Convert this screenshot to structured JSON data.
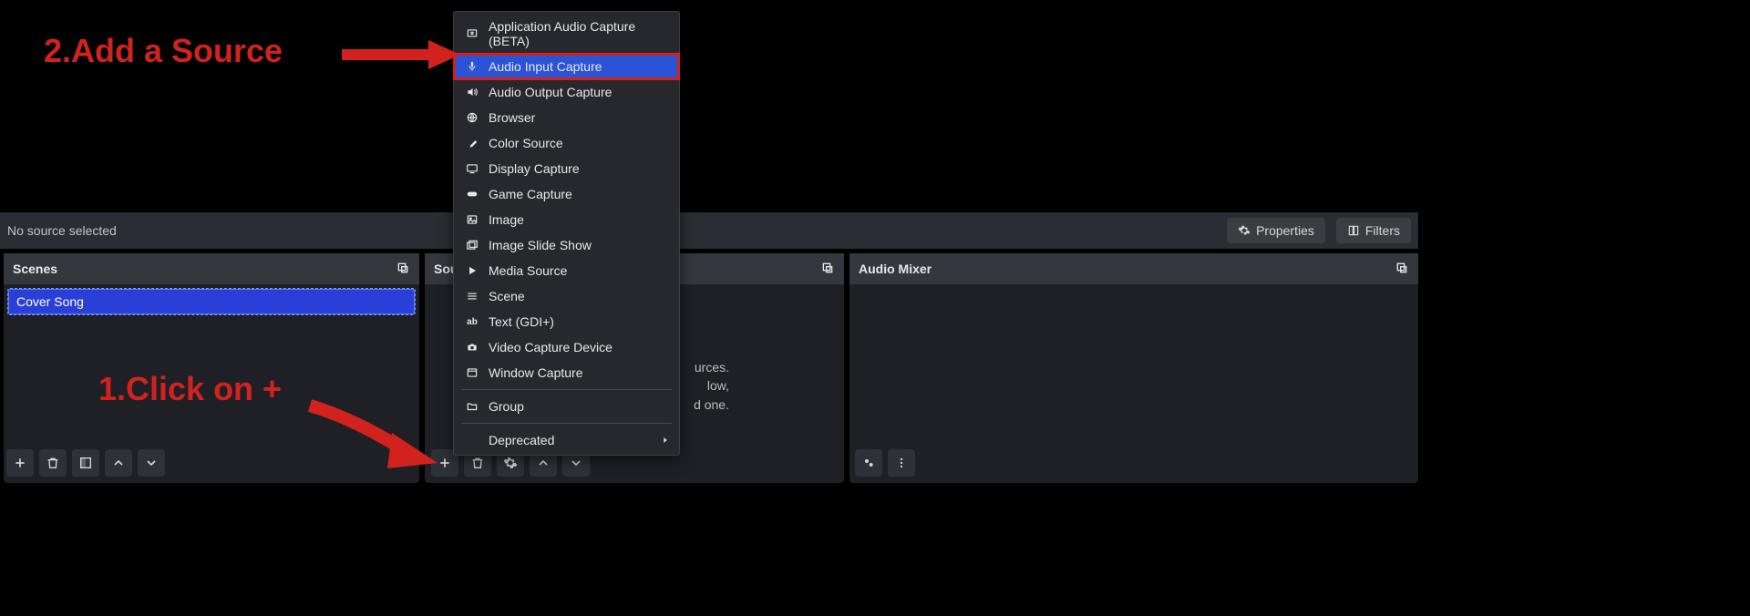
{
  "midbar": {
    "no_source": "No source selected",
    "properties": "Properties",
    "filters": "Filters"
  },
  "panels": {
    "scenes": {
      "title": "Scenes",
      "item": "Cover Song"
    },
    "sources": {
      "title": "Sources",
      "hint1": "urces.",
      "hint2": "low,",
      "hint3": "d one."
    },
    "mixer": {
      "title": "Audio Mixer"
    }
  },
  "menu": {
    "items": [
      {
        "label": "Application Audio Capture (BETA)",
        "icon": "app-audio"
      },
      {
        "label": "Audio Input Capture",
        "icon": "mic",
        "highlight": true
      },
      {
        "label": "Audio Output Capture",
        "icon": "speaker"
      },
      {
        "label": "Browser",
        "icon": "globe"
      },
      {
        "label": "Color Source",
        "icon": "brush"
      },
      {
        "label": "Display Capture",
        "icon": "display"
      },
      {
        "label": "Game Capture",
        "icon": "gamepad"
      },
      {
        "label": "Image",
        "icon": "image"
      },
      {
        "label": "Image Slide Show",
        "icon": "slideshow"
      },
      {
        "label": "Media Source",
        "icon": "play"
      },
      {
        "label": "Scene",
        "icon": "scene"
      },
      {
        "label": "Text (GDI+)",
        "icon": "text"
      },
      {
        "label": "Video Capture Device",
        "icon": "camera"
      },
      {
        "label": "Window Capture",
        "icon": "window"
      }
    ],
    "group": "Group",
    "deprecated": "Deprecated"
  },
  "annotations": {
    "step1": "1.Click on +",
    "step2": "2.Add a Source"
  }
}
